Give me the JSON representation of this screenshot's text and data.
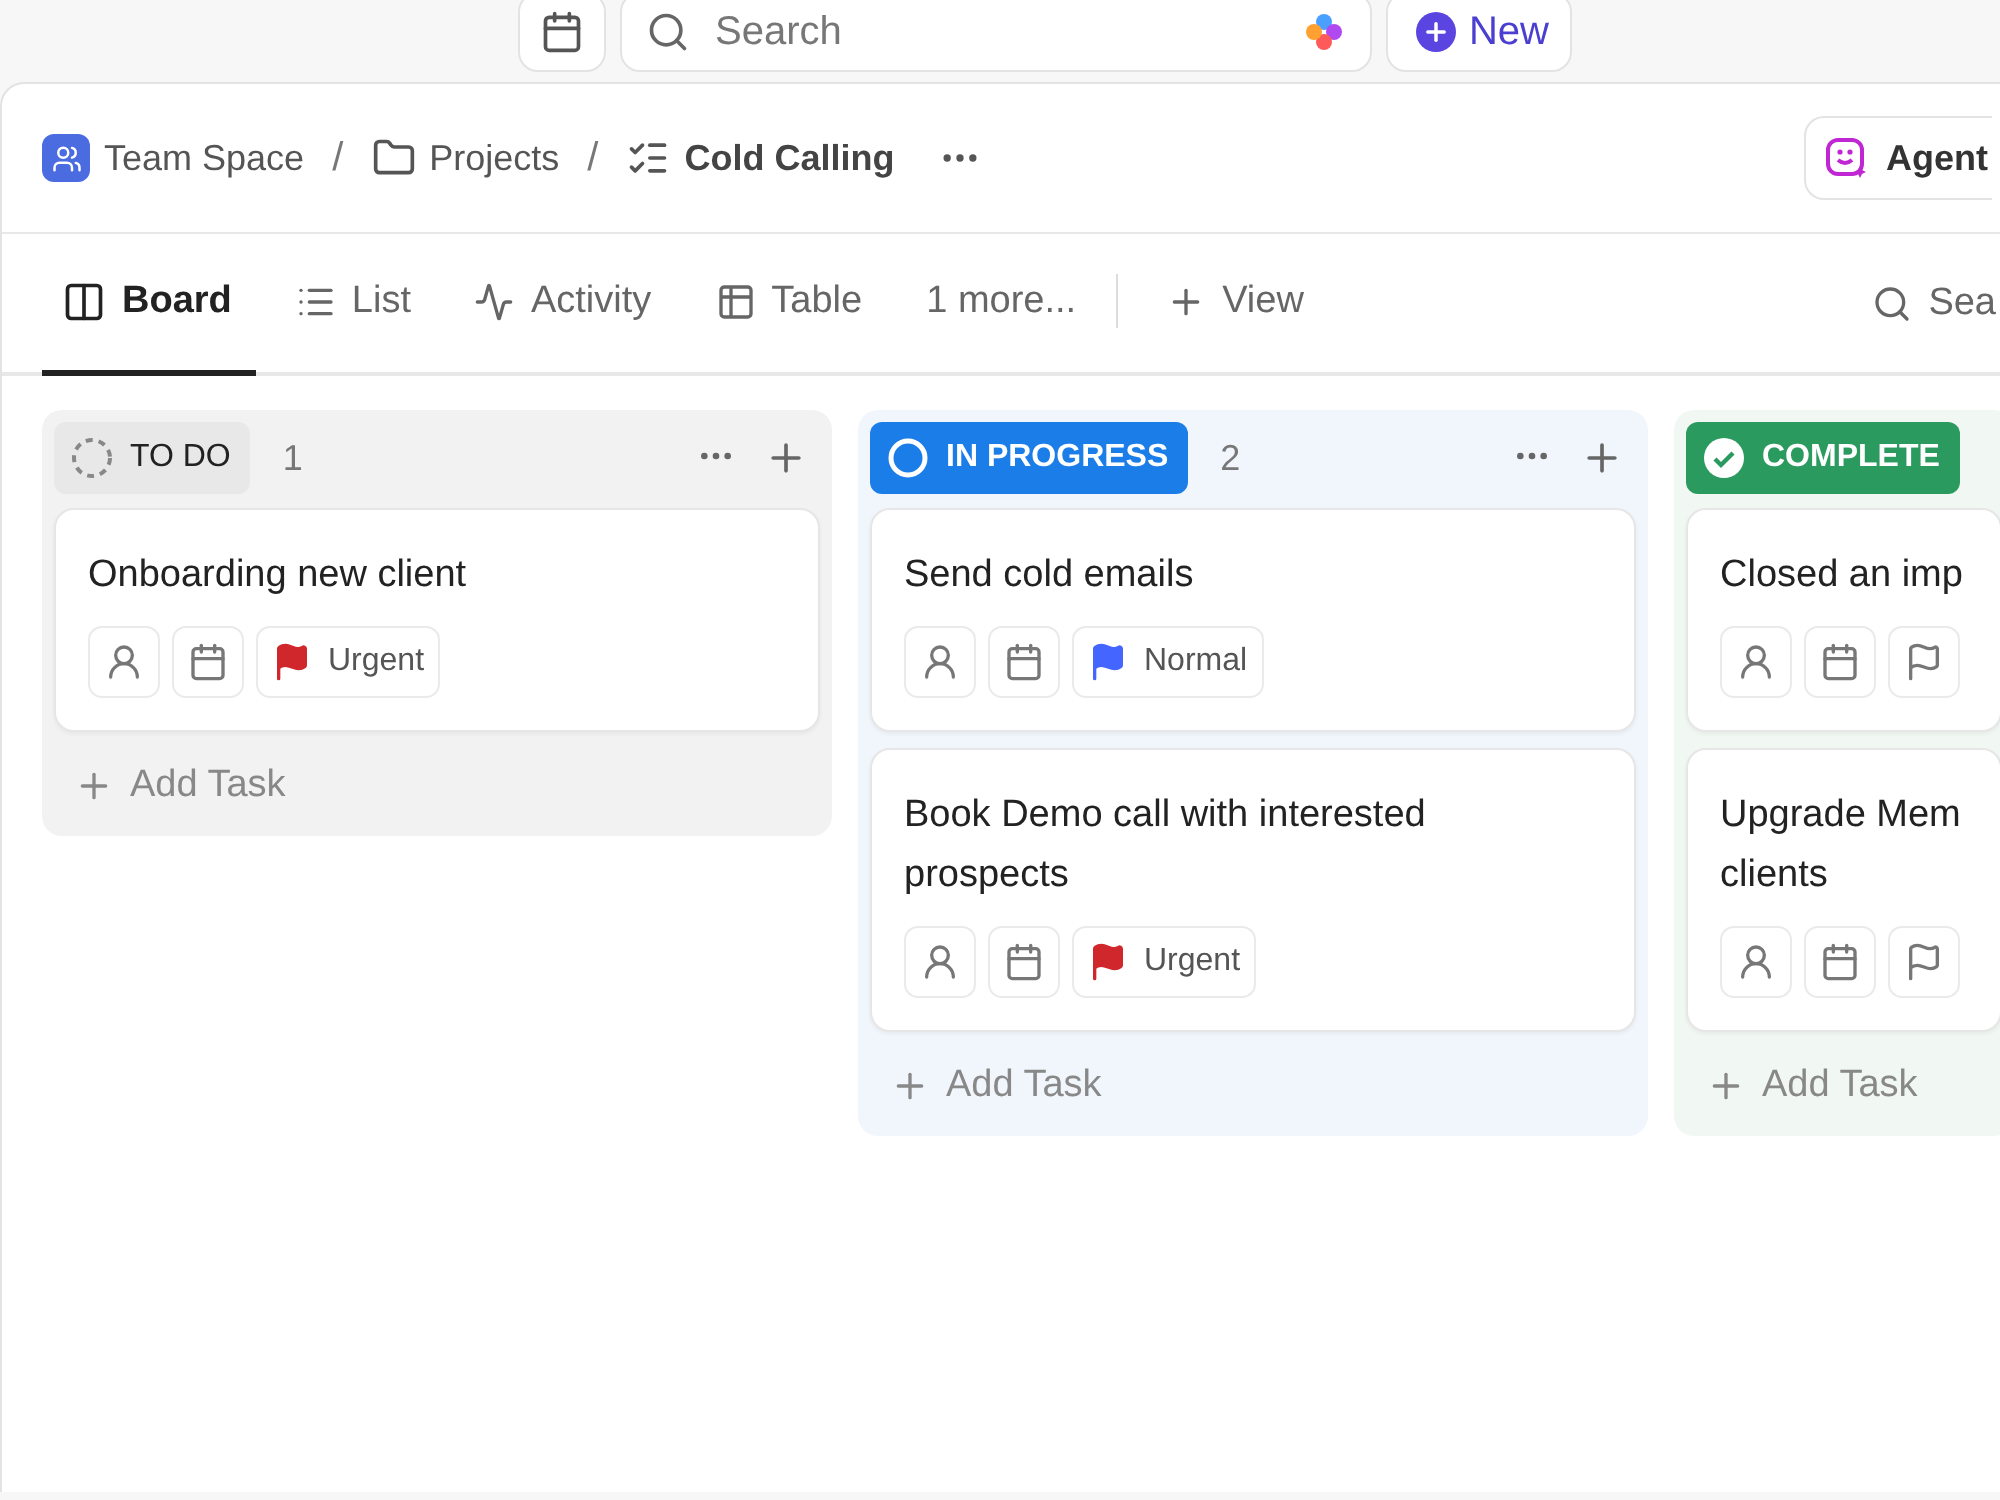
{
  "top_bar": {
    "search": {
      "placeholder": "Search"
    },
    "new_button": "New"
  },
  "breadcrumb": [
    {
      "label": "Team Space",
      "kind": "space"
    },
    {
      "label": "Projects",
      "kind": "folder"
    },
    {
      "label": "Cold Calling",
      "kind": "list"
    }
  ],
  "breadcrumb_separator": "/",
  "agent_button": "Agent",
  "view_tabs": [
    {
      "label": "Board",
      "kind": "board",
      "selected": true
    },
    {
      "label": "List",
      "kind": "list",
      "selected": false
    },
    {
      "label": "Activity",
      "kind": "activity",
      "selected": false
    },
    {
      "label": "Table",
      "kind": "table",
      "selected": false
    },
    {
      "label": "1 more...",
      "kind": "more",
      "selected": false
    }
  ],
  "add_view": "View",
  "search_views": "Sea",
  "columns": [
    {
      "status": "TO DO",
      "kind": "todo",
      "color": "#e8e8e8",
      "count": "1",
      "tasks": [
        {
          "title": "Onboarding new client",
          "priority": {
            "label": "Urgent",
            "color": "#d0272d"
          }
        }
      ],
      "add_task": "Add Task"
    },
    {
      "status": "IN PROGRESS",
      "kind": "progress",
      "color": "#1a7de8",
      "count": "2",
      "tasks": [
        {
          "title": "Send cold emails",
          "priority": {
            "label": "Normal",
            "color": "#4466ff"
          }
        },
        {
          "title": "Book Demo call with interested prospects",
          "priority": {
            "label": "Urgent",
            "color": "#d0272d"
          }
        }
      ],
      "add_task": "Add Task"
    },
    {
      "status": "COMPLETE",
      "kind": "complete",
      "color": "#2a9a5e",
      "tasks": [
        {
          "title": "Closed an imp"
        },
        {
          "title": "Upgrade Mem clients"
        }
      ],
      "add_task": "Add Task"
    }
  ]
}
